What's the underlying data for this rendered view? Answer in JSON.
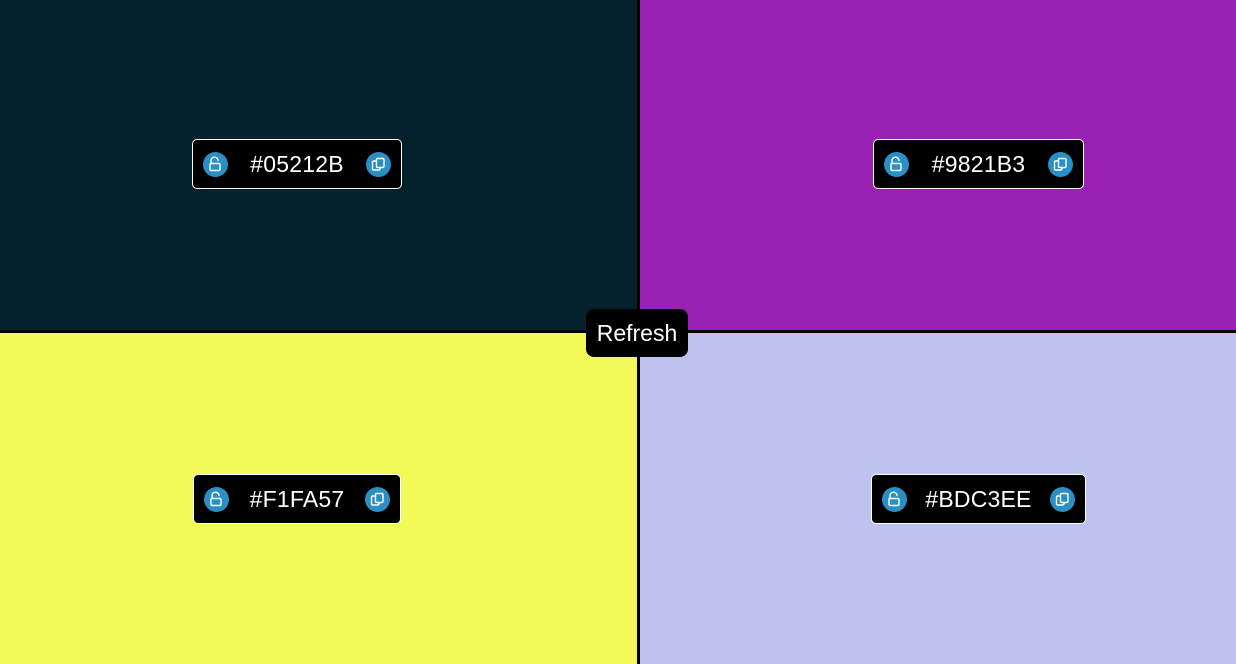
{
  "refresh": {
    "label": "Refresh"
  },
  "colors": [
    {
      "hex": "#05212B",
      "lock_icon": "unlock-icon",
      "copy_icon": "copy-icon"
    },
    {
      "hex": "#9821B3",
      "lock_icon": "unlock-icon",
      "copy_icon": "copy-icon"
    },
    {
      "hex": "#F1FA57",
      "lock_icon": "unlock-icon",
      "copy_icon": "copy-icon"
    },
    {
      "hex": "#BDC3EE",
      "lock_icon": "unlock-icon",
      "copy_icon": "copy-icon"
    }
  ],
  "theme": {
    "card_background": "#000000",
    "card_border": "#ffffff",
    "icon_button_color": "#2a8fc4",
    "divider_color": "#000000"
  }
}
